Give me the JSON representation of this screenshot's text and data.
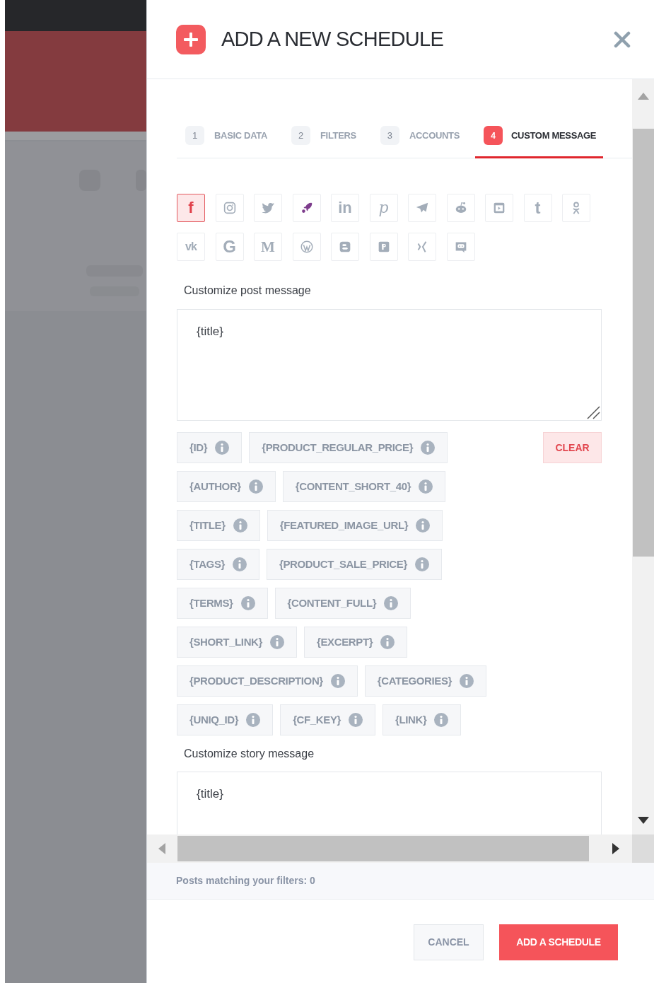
{
  "dialog": {
    "title": "ADD A NEW SCHEDULE"
  },
  "steps": [
    {
      "number": "1",
      "label": "BASIC DATA",
      "selected": false
    },
    {
      "number": "2",
      "label": "FILTERS",
      "selected": false
    },
    {
      "number": "3",
      "label": "ACCOUNTS",
      "selected": false
    },
    {
      "number": "4",
      "label": "CUSTOM MESSAGE",
      "selected": true
    }
  ],
  "networks": [
    {
      "glyph": "f",
      "selected": true
    },
    {
      "selected": false
    },
    {
      "selected": false
    },
    {
      "selected": false
    },
    {
      "glyph": "in",
      "selected": false
    },
    {
      "glyph": "p",
      "selected": false
    },
    {
      "selected": false
    },
    {
      "selected": false
    },
    {
      "selected": false
    },
    {
      "glyph": "t",
      "selected": false
    },
    {
      "selected": false
    },
    {
      "glyph": "vk",
      "selected": false
    },
    {
      "glyph": "G",
      "selected": false
    },
    {
      "glyph": "M",
      "selected": false
    },
    {
      "selected": false
    },
    {
      "selected": false
    },
    {
      "selected": false
    },
    {
      "selected": false
    },
    {
      "selected": false
    }
  ],
  "post_message": {
    "label": "Customize post message",
    "value": "{title}"
  },
  "variable_rows": [
    [
      "{ID}",
      "{PRODUCT_REGULAR_PRICE}"
    ],
    [
      "{AUTHOR}",
      "{CONTENT_SHORT_40}"
    ],
    [
      "{TITLE}",
      "{FEATURED_IMAGE_URL}"
    ],
    [
      "{TAGS}",
      "{PRODUCT_SALE_PRICE}"
    ],
    [
      "{TERMS}",
      "{CONTENT_FULL}"
    ],
    [
      "{SHORT_LINK}",
      "{EXCERPT}"
    ],
    [
      "{PRODUCT_DESCRIPTION}",
      "{CATEGORIES}"
    ],
    [
      "{UNIQ_ID}",
      "{CF_KEY}",
      "{LINK}"
    ]
  ],
  "clear_button": "CLEAR",
  "story_message": {
    "label": "Customize story message",
    "value": "{title}"
  },
  "status": "Posts matching your filters: 0",
  "buttons": {
    "cancel": "CANCEL",
    "submit": "ADD A SCHEDULE"
  }
}
